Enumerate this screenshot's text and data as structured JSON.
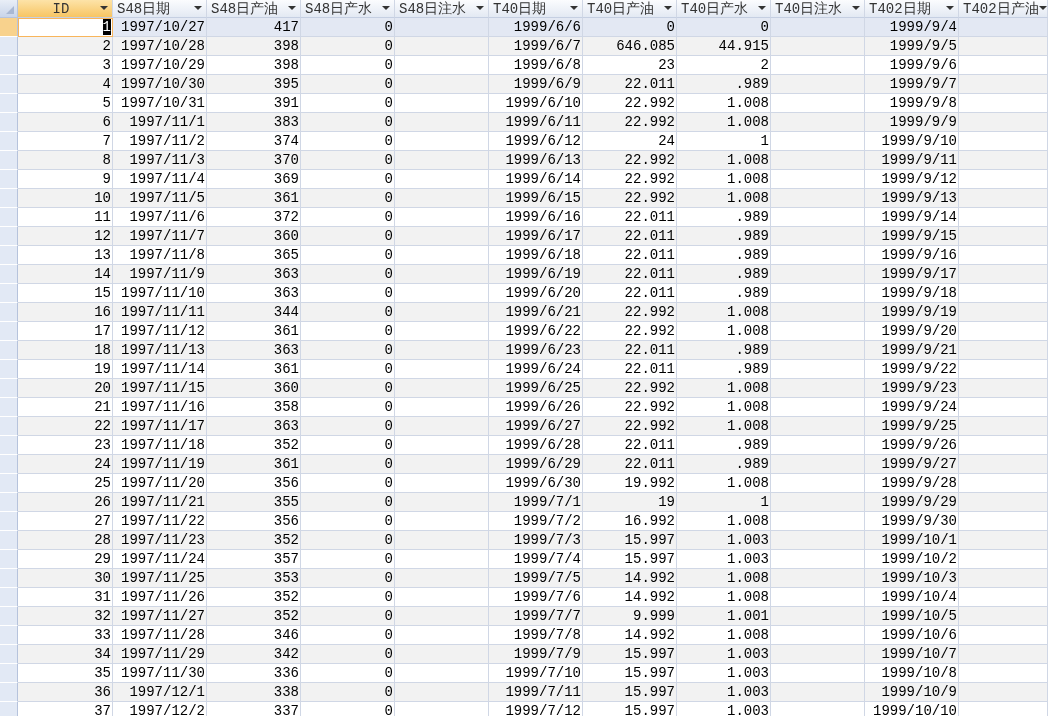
{
  "table": {
    "columns": [
      "ID",
      "S48日期",
      "S48日产油",
      "S48日产水",
      "S48日注水",
      "T40日期",
      "T40日产油",
      "T40日产水",
      "T40日注水",
      "T402日期",
      "T402日产油"
    ],
    "rows": [
      {
        "selected": true,
        "cells": [
          "1",
          "1997/10/27",
          "417",
          "0",
          null,
          "1999/6/6",
          "0",
          "0",
          null,
          "1999/9/4",
          null
        ]
      },
      {
        "selected": false,
        "cells": [
          "2",
          "1997/10/28",
          "398",
          "0",
          null,
          "1999/6/7",
          "646.085",
          "44.915",
          null,
          "1999/9/5",
          null
        ]
      },
      {
        "selected": false,
        "cells": [
          "3",
          "1997/10/29",
          "398",
          "0",
          null,
          "1999/6/8",
          "23",
          "2",
          null,
          "1999/9/6",
          null
        ]
      },
      {
        "selected": false,
        "cells": [
          "4",
          "1997/10/30",
          "395",
          "0",
          null,
          "1999/6/9",
          "22.011",
          ".989",
          null,
          "1999/9/7",
          null
        ]
      },
      {
        "selected": false,
        "cells": [
          "5",
          "1997/10/31",
          "391",
          "0",
          null,
          "1999/6/10",
          "22.992",
          "1.008",
          null,
          "1999/9/8",
          null
        ]
      },
      {
        "selected": false,
        "cells": [
          "6",
          "1997/11/1",
          "383",
          "0",
          null,
          "1999/6/11",
          "22.992",
          "1.008",
          null,
          "1999/9/9",
          null
        ]
      },
      {
        "selected": false,
        "cells": [
          "7",
          "1997/11/2",
          "374",
          "0",
          null,
          "1999/6/12",
          "24",
          "1",
          null,
          "1999/9/10",
          null
        ]
      },
      {
        "selected": false,
        "cells": [
          "8",
          "1997/11/3",
          "370",
          "0",
          null,
          "1999/6/13",
          "22.992",
          "1.008",
          null,
          "1999/9/11",
          null
        ]
      },
      {
        "selected": false,
        "cells": [
          "9",
          "1997/11/4",
          "369",
          "0",
          null,
          "1999/6/14",
          "22.992",
          "1.008",
          null,
          "1999/9/12",
          null
        ]
      },
      {
        "selected": false,
        "cells": [
          "10",
          "1997/11/5",
          "361",
          "0",
          null,
          "1999/6/15",
          "22.992",
          "1.008",
          null,
          "1999/9/13",
          null
        ]
      },
      {
        "selected": false,
        "cells": [
          "11",
          "1997/11/6",
          "372",
          "0",
          null,
          "1999/6/16",
          "22.011",
          ".989",
          null,
          "1999/9/14",
          null
        ]
      },
      {
        "selected": false,
        "cells": [
          "12",
          "1997/11/7",
          "360",
          "0",
          null,
          "1999/6/17",
          "22.011",
          ".989",
          null,
          "1999/9/15",
          null
        ]
      },
      {
        "selected": false,
        "cells": [
          "13",
          "1997/11/8",
          "365",
          "0",
          null,
          "1999/6/18",
          "22.011",
          ".989",
          null,
          "1999/9/16",
          null
        ]
      },
      {
        "selected": false,
        "cells": [
          "14",
          "1997/11/9",
          "363",
          "0",
          null,
          "1999/6/19",
          "22.011",
          ".989",
          null,
          "1999/9/17",
          null
        ]
      },
      {
        "selected": false,
        "cells": [
          "15",
          "1997/11/10",
          "363",
          "0",
          null,
          "1999/6/20",
          "22.011",
          ".989",
          null,
          "1999/9/18",
          null
        ]
      },
      {
        "selected": false,
        "cells": [
          "16",
          "1997/11/11",
          "344",
          "0",
          null,
          "1999/6/21",
          "22.992",
          "1.008",
          null,
          "1999/9/19",
          null
        ]
      },
      {
        "selected": false,
        "cells": [
          "17",
          "1997/11/12",
          "361",
          "0",
          null,
          "1999/6/22",
          "22.992",
          "1.008",
          null,
          "1999/9/20",
          null
        ]
      },
      {
        "selected": false,
        "cells": [
          "18",
          "1997/11/13",
          "363",
          "0",
          null,
          "1999/6/23",
          "22.011",
          ".989",
          null,
          "1999/9/21",
          null
        ]
      },
      {
        "selected": false,
        "cells": [
          "19",
          "1997/11/14",
          "361",
          "0",
          null,
          "1999/6/24",
          "22.011",
          ".989",
          null,
          "1999/9/22",
          null
        ]
      },
      {
        "selected": false,
        "cells": [
          "20",
          "1997/11/15",
          "360",
          "0",
          null,
          "1999/6/25",
          "22.992",
          "1.008",
          null,
          "1999/9/23",
          null
        ]
      },
      {
        "selected": false,
        "cells": [
          "21",
          "1997/11/16",
          "358",
          "0",
          null,
          "1999/6/26",
          "22.992",
          "1.008",
          null,
          "1999/9/24",
          null
        ]
      },
      {
        "selected": false,
        "cells": [
          "22",
          "1997/11/17",
          "363",
          "0",
          null,
          "1999/6/27",
          "22.992",
          "1.008",
          null,
          "1999/9/25",
          null
        ]
      },
      {
        "selected": false,
        "cells": [
          "23",
          "1997/11/18",
          "352",
          "0",
          null,
          "1999/6/28",
          "22.011",
          ".989",
          null,
          "1999/9/26",
          null
        ]
      },
      {
        "selected": false,
        "cells": [
          "24",
          "1997/11/19",
          "361",
          "0",
          null,
          "1999/6/29",
          "22.011",
          ".989",
          null,
          "1999/9/27",
          null
        ]
      },
      {
        "selected": false,
        "cells": [
          "25",
          "1997/11/20",
          "356",
          "0",
          null,
          "1999/6/30",
          "19.992",
          "1.008",
          null,
          "1999/9/28",
          null
        ]
      },
      {
        "selected": false,
        "cells": [
          "26",
          "1997/11/21",
          "355",
          "0",
          null,
          "1999/7/1",
          "19",
          "1",
          null,
          "1999/9/29",
          null
        ]
      },
      {
        "selected": false,
        "cells": [
          "27",
          "1997/11/22",
          "356",
          "0",
          null,
          "1999/7/2",
          "16.992",
          "1.008",
          null,
          "1999/9/30",
          null
        ]
      },
      {
        "selected": false,
        "cells": [
          "28",
          "1997/11/23",
          "352",
          "0",
          null,
          "1999/7/3",
          "15.997",
          "1.003",
          null,
          "1999/10/1",
          null
        ]
      },
      {
        "selected": false,
        "cells": [
          "29",
          "1997/11/24",
          "357",
          "0",
          null,
          "1999/7/4",
          "15.997",
          "1.003",
          null,
          "1999/10/2",
          null
        ]
      },
      {
        "selected": false,
        "cells": [
          "30",
          "1997/11/25",
          "353",
          "0",
          null,
          "1999/7/5",
          "14.992",
          "1.008",
          null,
          "1999/10/3",
          null
        ]
      },
      {
        "selected": false,
        "cells": [
          "31",
          "1997/11/26",
          "352",
          "0",
          null,
          "1999/7/6",
          "14.992",
          "1.008",
          null,
          "1999/10/4",
          null
        ]
      },
      {
        "selected": false,
        "cells": [
          "32",
          "1997/11/27",
          "352",
          "0",
          null,
          "1999/7/7",
          "9.999",
          "1.001",
          null,
          "1999/10/5",
          null
        ]
      },
      {
        "selected": false,
        "cells": [
          "33",
          "1997/11/28",
          "346",
          "0",
          null,
          "1999/7/8",
          "14.992",
          "1.008",
          null,
          "1999/10/6",
          null
        ]
      },
      {
        "selected": false,
        "cells": [
          "34",
          "1997/11/29",
          "342",
          "0",
          null,
          "1999/7/9",
          "15.997",
          "1.003",
          null,
          "1999/10/7",
          null
        ]
      },
      {
        "selected": false,
        "cells": [
          "35",
          "1997/11/30",
          "336",
          "0",
          null,
          "1999/7/10",
          "15.997",
          "1.003",
          null,
          "1999/10/8",
          null
        ]
      },
      {
        "selected": false,
        "cells": [
          "36",
          "1997/12/1",
          "338",
          "0",
          null,
          "1999/7/11",
          "15.997",
          "1.003",
          null,
          "1999/10/9",
          null
        ]
      },
      {
        "selected": false,
        "cells": [
          "37",
          "1997/12/2",
          "337",
          "0",
          null,
          "1999/7/12",
          "15.997",
          "1.003",
          null,
          "1999/10/10",
          null
        ]
      }
    ]
  }
}
